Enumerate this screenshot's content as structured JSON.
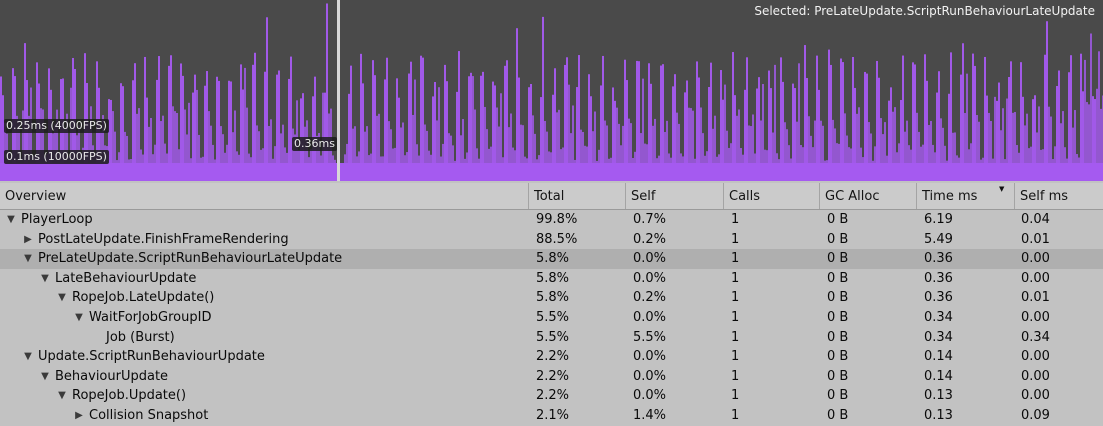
{
  "graph": {
    "selected_label": "Selected: PreLateUpdate.ScriptRunBehaviourLateUpdate",
    "ref_label_high": "0.25ms (4000FPS)",
    "ref_label_low": "0.1ms (10000FPS)",
    "cursor_value": "0.36ms",
    "bar_color": "#a55af0",
    "background_color": "#4a4a4a"
  },
  "columns": [
    "Overview",
    "Total",
    "Self",
    "Calls",
    "GC Alloc",
    "Time ms",
    "Self ms"
  ],
  "sort_indicator": "▼",
  "rows": [
    {
      "name": "PlayerLoop",
      "depth": 0,
      "expander": "▼",
      "total": "99.8%",
      "self": "0.7%",
      "calls": "1",
      "gc": "0 B",
      "time": "6.19",
      "self_ms": "0.04",
      "selected": false
    },
    {
      "name": "PostLateUpdate.FinishFrameRendering",
      "depth": 1,
      "expander": "▶",
      "total": "88.5%",
      "self": "0.2%",
      "calls": "1",
      "gc": "0 B",
      "time": "5.49",
      "self_ms": "0.01",
      "selected": false
    },
    {
      "name": "PreLateUpdate.ScriptRunBehaviourLateUpdate",
      "depth": 1,
      "expander": "▼",
      "total": "5.8%",
      "self": "0.0%",
      "calls": "1",
      "gc": "0 B",
      "time": "0.36",
      "self_ms": "0.00",
      "selected": true
    },
    {
      "name": "LateBehaviourUpdate",
      "depth": 2,
      "expander": "▼",
      "total": "5.8%",
      "self": "0.0%",
      "calls": "1",
      "gc": "0 B",
      "time": "0.36",
      "self_ms": "0.00",
      "selected": false
    },
    {
      "name": "RopeJob.LateUpdate()",
      "depth": 3,
      "expander": "▼",
      "total": "5.8%",
      "self": "0.2%",
      "calls": "1",
      "gc": "0 B",
      "time": "0.36",
      "self_ms": "0.01",
      "selected": false
    },
    {
      "name": "WaitForJobGroupID",
      "depth": 4,
      "expander": "▼",
      "total": "5.5%",
      "self": "0.0%",
      "calls": "1",
      "gc": "0 B",
      "time": "0.34",
      "self_ms": "0.00",
      "selected": false
    },
    {
      "name": "Job (Burst)",
      "depth": 5,
      "expander": "",
      "total": "5.5%",
      "self": "5.5%",
      "calls": "1",
      "gc": "0 B",
      "time": "0.34",
      "self_ms": "0.34",
      "selected": false
    },
    {
      "name": "Update.ScriptRunBehaviourUpdate",
      "depth": 1,
      "expander": "▼",
      "total": "2.2%",
      "self": "0.0%",
      "calls": "1",
      "gc": "0 B",
      "time": "0.14",
      "self_ms": "0.00",
      "selected": false
    },
    {
      "name": "BehaviourUpdate",
      "depth": 2,
      "expander": "▼",
      "total": "2.2%",
      "self": "0.0%",
      "calls": "1",
      "gc": "0 B",
      "time": "0.14",
      "self_ms": "0.00",
      "selected": false
    },
    {
      "name": "RopeJob.Update()",
      "depth": 3,
      "expander": "▼",
      "total": "2.2%",
      "self": "0.0%",
      "calls": "1",
      "gc": "0 B",
      "time": "0.13",
      "self_ms": "0.00",
      "selected": false
    },
    {
      "name": "Collision Snapshot",
      "depth": 4,
      "expander": "▶",
      "total": "2.1%",
      "self": "1.4%",
      "calls": "1",
      "gc": "0 B",
      "time": "0.13",
      "self_ms": "0.09",
      "selected": false
    }
  ]
}
